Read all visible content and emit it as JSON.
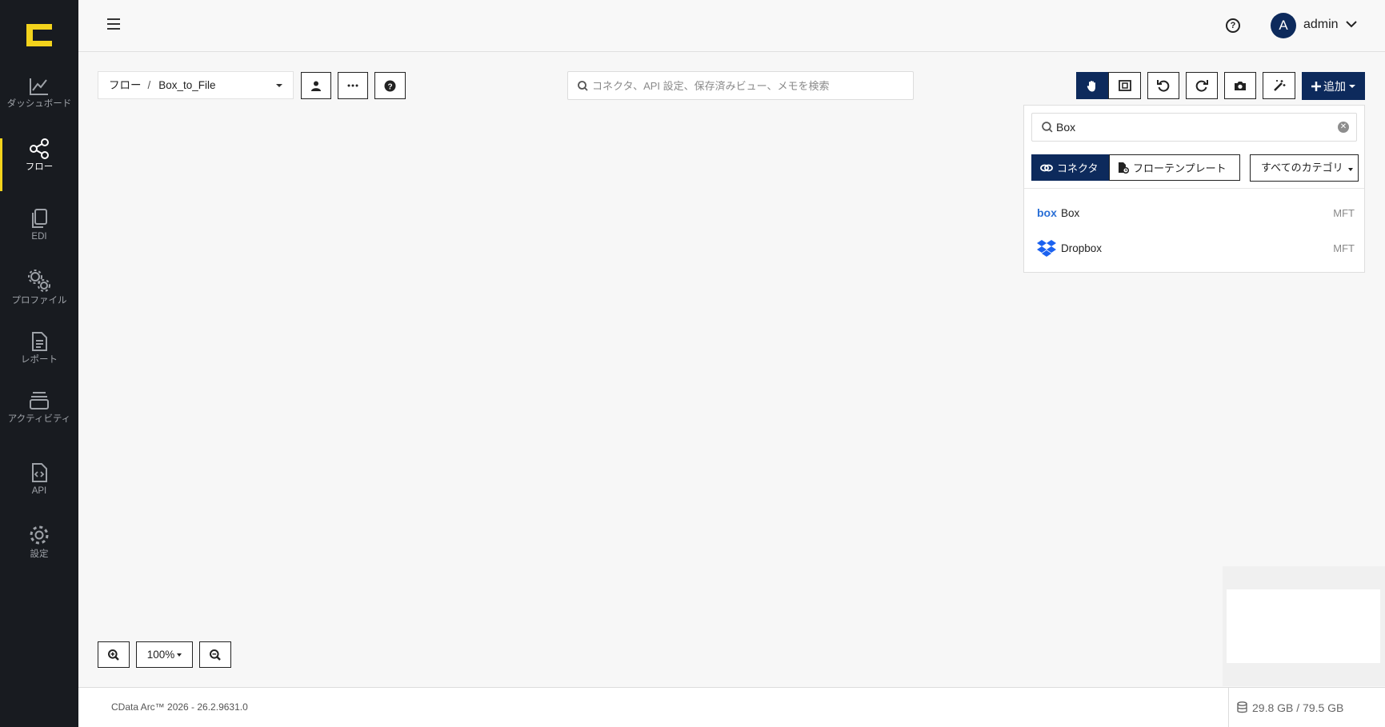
{
  "sidebar": {
    "logo_icon": "cdata-logo",
    "items": [
      {
        "label": "ダッシュボード",
        "icon": "line-chart-icon",
        "active": false
      },
      {
        "label": "フロー",
        "icon": "share-nodes-icon",
        "active": true
      },
      {
        "label": "EDI",
        "icon": "copy-icon",
        "active": false
      },
      {
        "label": "プロファイル",
        "icon": "gears-icon",
        "active": false
      },
      {
        "label": "レポート",
        "icon": "document-icon",
        "active": false
      },
      {
        "label": "アクティビティ",
        "icon": "layers-icon",
        "active": false
      },
      {
        "label": "API",
        "icon": "code-file-icon",
        "active": false
      },
      {
        "label": "設定",
        "icon": "gear-icon",
        "active": false
      }
    ],
    "accent_color": "#f3d31c",
    "background": "#181b20"
  },
  "header": {
    "help_icon": "question-circle-icon",
    "avatar_initial": "A",
    "username": "admin"
  },
  "toolbar": {
    "breadcrumb_root": "フロー",
    "breadcrumb_separator": "/",
    "flow_name": "Box_to_File",
    "search_placeholder": "コネクタ、API 設定、保存済みビュー、メモを検索",
    "add_label": "追加",
    "brand_color": "#0d2a5c"
  },
  "add_panel": {
    "search_value": "Box",
    "tab_connectors": "コネクタ",
    "tab_templates": "フローテンプレート",
    "category_select": "すべてのカテゴリ",
    "results": [
      {
        "name": "Box",
        "tag": "MFT",
        "icon": "box-logo-icon"
      },
      {
        "name": "Dropbox",
        "tag": "MFT",
        "icon": "dropbox-logo-icon"
      }
    ]
  },
  "zoom": {
    "level": "100%"
  },
  "footer": {
    "version": "CData Arc™ 2026 - 26.2.9631.0",
    "storage": "29.8 GB / 79.5 GB"
  }
}
